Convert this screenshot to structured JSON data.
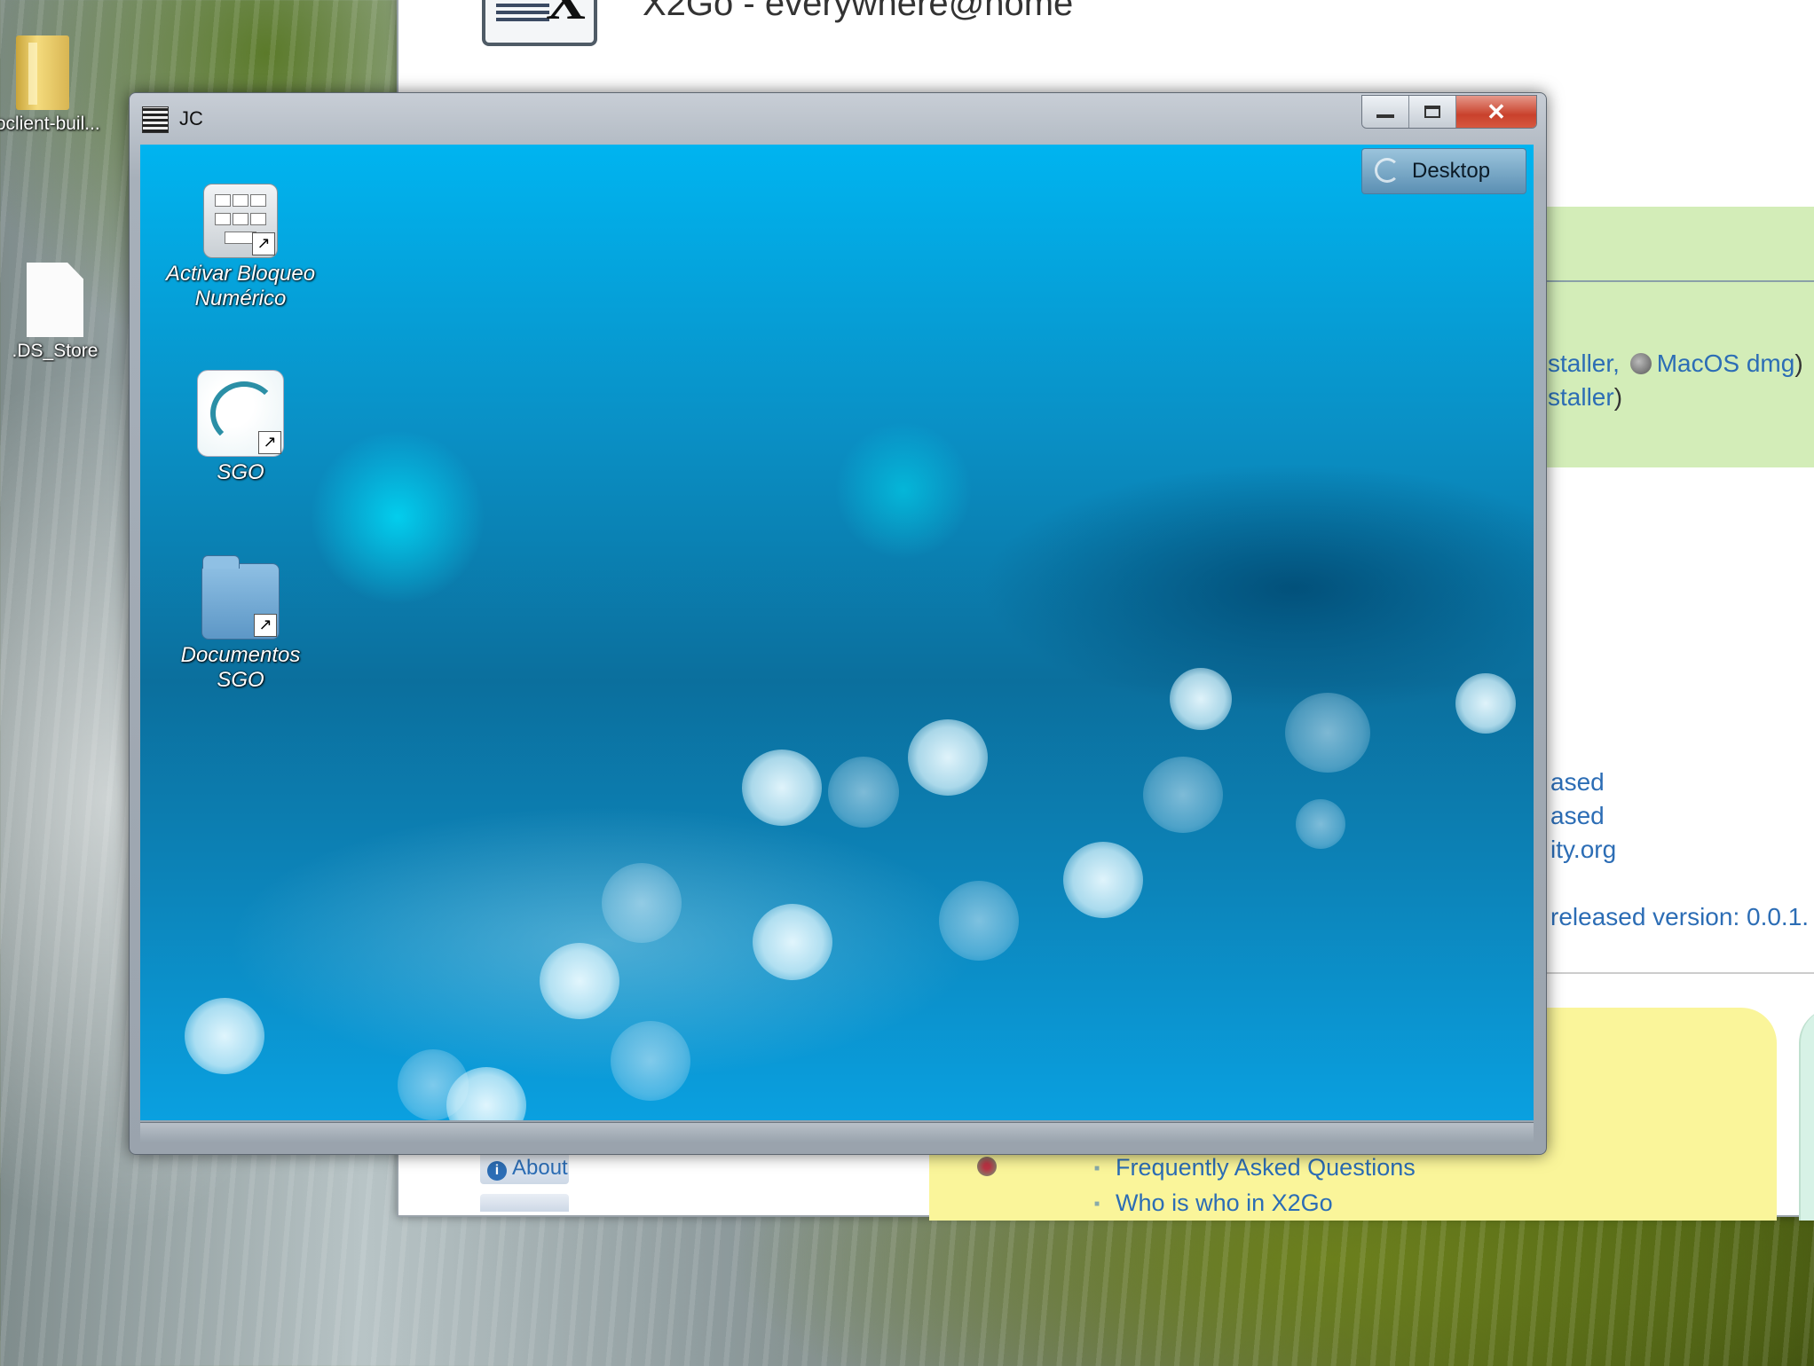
{
  "desktop": {
    "icons": [
      {
        "label": "goclient-buil...",
        "icon": "folder-icon"
      },
      {
        "label": ".DS_Store",
        "icon": "file-icon"
      }
    ]
  },
  "browser": {
    "site_title": "X2Go - everywhere@home",
    "green_panel": {
      "line1_text": "staller,",
      "line1_link": "MacOS dmg",
      "line1_suffix": ")",
      "line2_text": "staller",
      "line2_suffix": ")"
    },
    "news": [
      "ased",
      "ased",
      "ity.org"
    ],
    "released_version": "released version: 0.0.1.",
    "about_label": "About",
    "faq_items": [
      "Frequently Asked Questions",
      "Who is who in X2Go"
    ]
  },
  "remote_window": {
    "title": "JC",
    "buttons": {
      "minimize": "minimize",
      "maximize": "maximize",
      "close": "close"
    },
    "desktop_button_label": "Desktop",
    "icons": [
      {
        "label_line1": "Activar Bloqueo",
        "label_line2": "Numérico",
        "icon": "keyboard-icon"
      },
      {
        "label_line1": "SGO",
        "label_line2": "",
        "icon": "sgo-app-icon"
      },
      {
        "label_line1": "Documentos",
        "label_line2": "SGO",
        "icon": "folder-icon"
      }
    ]
  }
}
